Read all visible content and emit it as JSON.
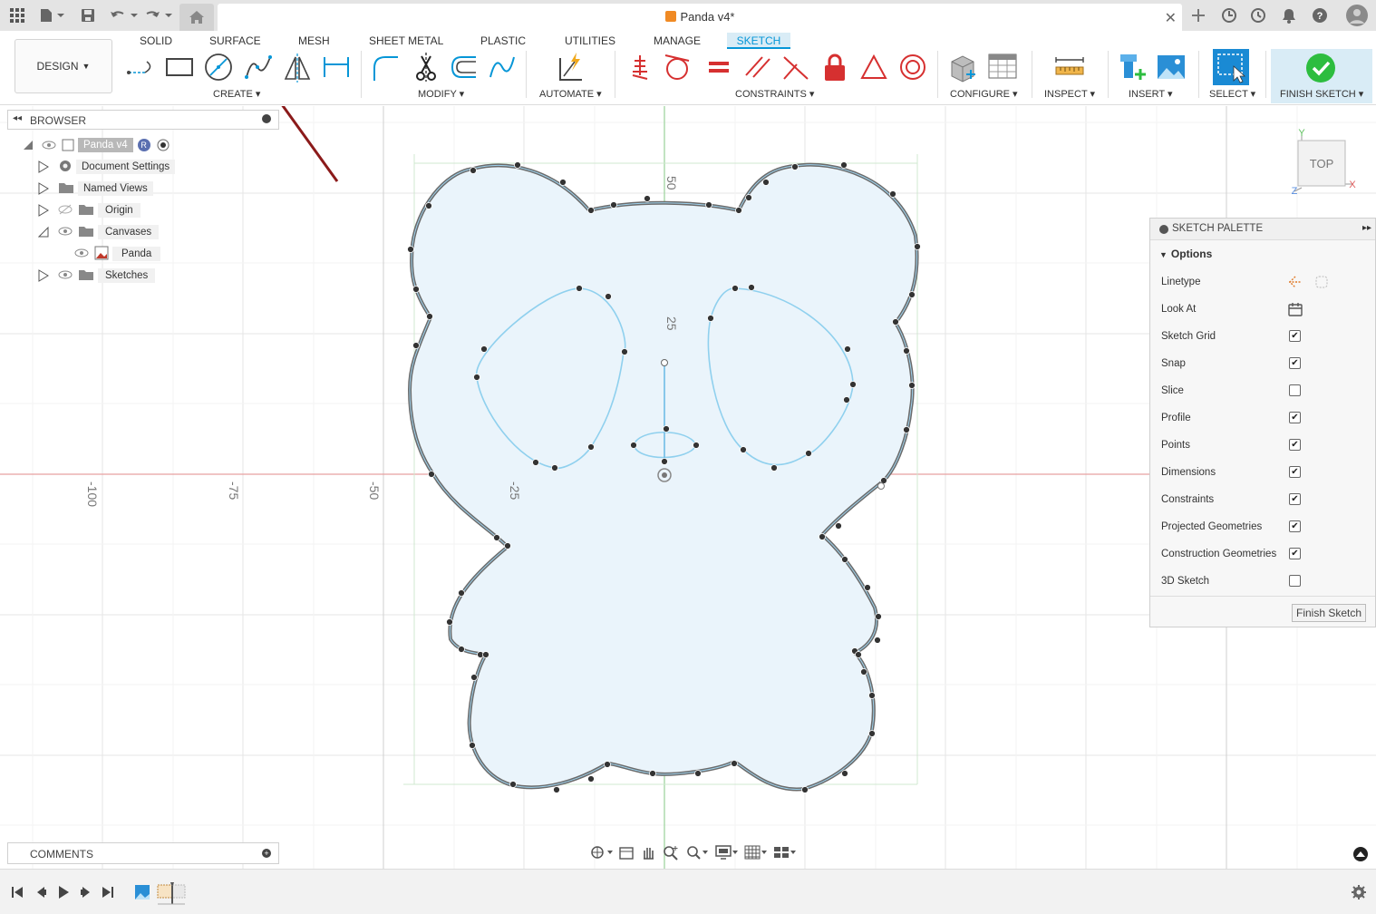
{
  "app": {
    "document_title": "Panda v4*"
  },
  "toolbar": {
    "design_label": "DESIGN",
    "tabs": [
      "SOLID",
      "SURFACE",
      "MESH",
      "SHEET METAL",
      "PLASTIC",
      "UTILITIES",
      "MANAGE",
      "SKETCH"
    ],
    "active_tab": "SKETCH",
    "groups": {
      "create": "CREATE",
      "modify": "MODIFY",
      "automate": "AUTOMATE",
      "constraints": "CONSTRAINTS",
      "configure": "CONFIGURE",
      "inspect": "INSPECT",
      "insert": "INSERT",
      "select": "SELECT",
      "finish": "FINISH SKETCH"
    }
  },
  "browser": {
    "title": "BROWSER",
    "root": "Panda v4",
    "items": [
      "Document Settings",
      "Named Views",
      "Origin",
      "Canvases",
      "Panda",
      "Sketches"
    ]
  },
  "sketch_palette": {
    "title": "SKETCH PALETTE",
    "section": "Options",
    "linetype": "Linetype",
    "look_at": "Look At",
    "options": [
      {
        "label": "Sketch Grid",
        "checked": true
      },
      {
        "label": "Snap",
        "checked": true
      },
      {
        "label": "Slice",
        "checked": false
      },
      {
        "label": "Profile",
        "checked": true
      },
      {
        "label": "Points",
        "checked": true
      },
      {
        "label": "Dimensions",
        "checked": true
      },
      {
        "label": "Constraints",
        "checked": true
      },
      {
        "label": "Projected Geometries",
        "checked": true
      },
      {
        "label": "Construction Geometries",
        "checked": true
      },
      {
        "label": "3D Sketch",
        "checked": false
      }
    ],
    "finish_button": "Finish Sketch"
  },
  "canvas": {
    "axis_labels": [
      "-100",
      "-75",
      "-50",
      "-25",
      "50",
      "25"
    ],
    "viewcube": "TOP",
    "axis_x": "X",
    "axis_y": "Y",
    "axis_z": "Z"
  },
  "comments": {
    "title": "COMMENTS"
  },
  "colors": {
    "accent": "#0696d7",
    "x_axis": "#e06060",
    "y_axis": "#60c060",
    "sketch_fill": "#eaf4fb",
    "profile_line": "#6b6b6b",
    "spline": "#8fd0ee",
    "finish_green": "#2dbd3f",
    "annotation_arrow": "#8b1a1a"
  }
}
